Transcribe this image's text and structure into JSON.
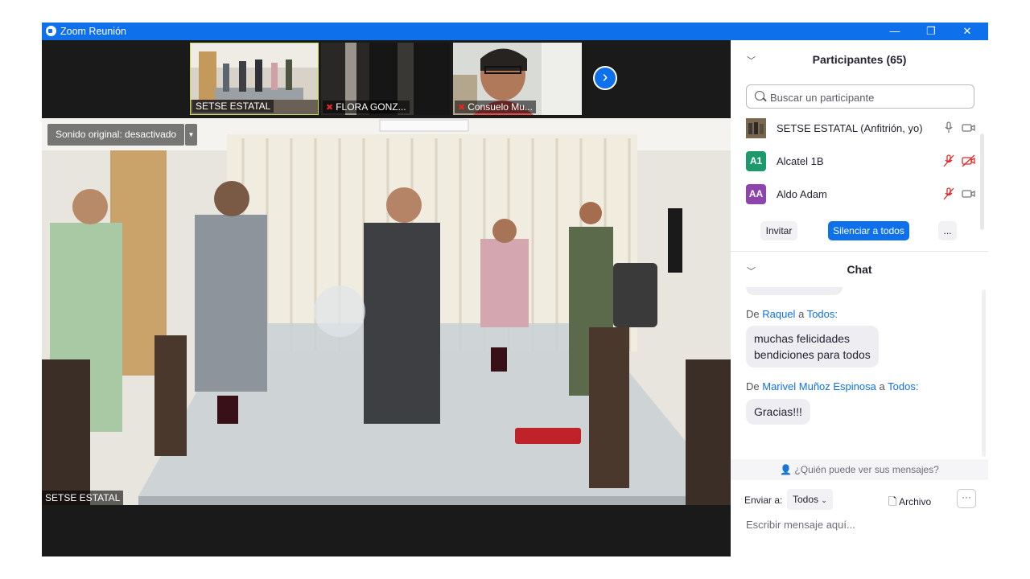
{
  "window": {
    "title": "Zoom Reunión",
    "minimize_glyph": "—",
    "restore_glyph": "❐",
    "close_glyph": "✕"
  },
  "gallery": {
    "thumbnails": [
      {
        "label": "SETSE ESTATAL",
        "muted": false
      },
      {
        "label": "FLORA GONZ...",
        "muted": true
      },
      {
        "label": "Consuelo Mu...",
        "muted": true
      }
    ],
    "next_icon": "chevron-right-icon"
  },
  "main_video": {
    "original_sound_label": "Sonido original: desactivado",
    "speaker_label": "SETSE ESTATAL"
  },
  "participants": {
    "title": "Participantes (65)",
    "search_placeholder": "Buscar un participante",
    "list": [
      {
        "name": "SETSE ESTATAL (Anfitrión, yo)",
        "initials": "",
        "avatar_color": "#6a5a44",
        "mic": "on",
        "video": "on"
      },
      {
        "name": "Alcatel 1B",
        "initials": "A1",
        "avatar_color": "#1d9a6c",
        "mic": "muted",
        "video": "off"
      },
      {
        "name": "Aldo Adam",
        "initials": "AA",
        "avatar_color": "#8e44ad",
        "mic": "muted",
        "video": "on"
      }
    ],
    "invite_label": "Invitar",
    "mute_all_label": "Silenciar a todos",
    "more_label": "..."
  },
  "chat": {
    "title": "Chat",
    "messages": [
      {
        "from_prefix": "De",
        "sender": "Raquel",
        "to_word": "a",
        "recipient": "Todos:",
        "lines": [
          "muchas felicidades",
          "bendiciones para todos"
        ]
      },
      {
        "from_prefix": "De",
        "sender": "Marivel Muñoz Espinosa",
        "to_word": "a",
        "recipient": "Todos:",
        "lines": [
          "Gracias!!!"
        ]
      }
    ],
    "who_can_see": "¿Quién puede ver sus mensajes?",
    "send_to_label": "Enviar a:",
    "send_to_value": "Todos",
    "file_label": "Archivo",
    "more_label": "···",
    "compose_placeholder": "Escribir mensaje aquí..."
  },
  "colors": {
    "titlebar": "#0e71eb",
    "accent": "#0e71eb",
    "muted_red": "#e02828"
  }
}
